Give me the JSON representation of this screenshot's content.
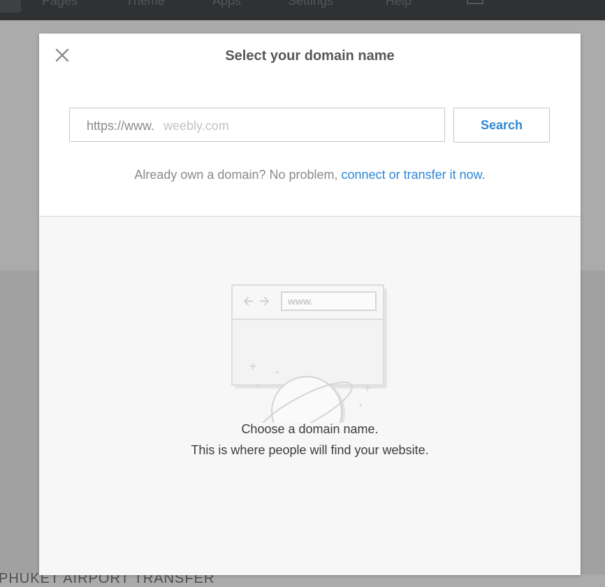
{
  "nav": {
    "items": [
      "Pages",
      "Theme",
      "Apps",
      "Settings",
      "Help"
    ],
    "preview_icon": "monitor-icon"
  },
  "background": {
    "site_title": "PHUKET AIRPORT TRANSFER"
  },
  "modal": {
    "title": "Select your domain name",
    "close_icon": "close-icon",
    "input": {
      "prefix": "https://www.",
      "placeholder": "weebly.com"
    },
    "search_label": "Search",
    "already_own_text": "Already own a domain? No problem,",
    "already_own_link": "connect or transfer it now.",
    "illustration": {
      "url_text": "www.",
      "icon": "browser-planet-illustration"
    },
    "empty_state": {
      "line1": "Choose a domain name.",
      "line2": "This is where people will find your website."
    }
  },
  "colors": {
    "accent": "#2e88d7",
    "title": "#555759",
    "muted_text": "#8a8a8a",
    "top_bar": "#2f3133"
  }
}
